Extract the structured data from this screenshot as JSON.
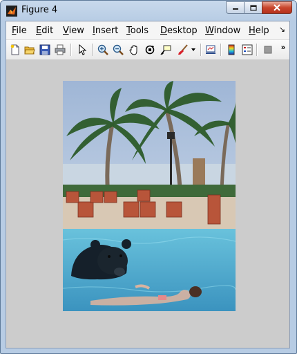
{
  "window": {
    "title": "Figure 4"
  },
  "menubar": {
    "items": [
      {
        "label": "File",
        "key": "F",
        "rest": "ile"
      },
      {
        "label": "Edit",
        "key": "E",
        "rest": "dit"
      },
      {
        "label": "View",
        "key": "V",
        "rest": "iew"
      },
      {
        "label": "Insert",
        "key": "I",
        "rest": "nsert"
      },
      {
        "label": "Tools",
        "key": "T",
        "rest": "ools"
      },
      {
        "label": "Desktop",
        "key": "D",
        "rest": "esktop"
      },
      {
        "label": "Window",
        "key": "W",
        "rest": "indow"
      },
      {
        "label": "Help",
        "key": "H",
        "rest": "elp"
      }
    ],
    "overflow_glyph": "↘"
  },
  "toolbar": {
    "icons": [
      "new-figure-icon",
      "open-file-icon",
      "save-icon",
      "print-icon",
      "pointer-icon",
      "zoom-in-icon",
      "zoom-out-icon",
      "pan-icon",
      "rotate-3d-icon",
      "data-cursor-icon",
      "brush-icon",
      "link-plot-icon",
      "colorbar-icon",
      "legend-icon",
      "hide-plot-tools-icon"
    ],
    "overflow_glyph": "»"
  },
  "figure": {
    "image": {
      "description_icon": "pool-scene-image"
    }
  },
  "colors": {
    "figure_background": "#cccccc",
    "sky": "#b8c8dc",
    "pool": "#4aa8c8"
  }
}
